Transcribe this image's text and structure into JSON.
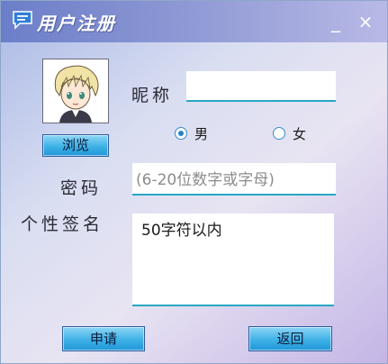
{
  "window": {
    "title": "用户注册",
    "minimize_icon": "minimize-icon",
    "close_icon": "close-icon",
    "app_icon": "chat-bubble-icon",
    "accent": "#27a8c3"
  },
  "avatar": {
    "icon": "anime-avatar-icon"
  },
  "buttons": {
    "browse": "浏览",
    "apply": "申请",
    "back": "返回"
  },
  "form": {
    "nickname_label": "昵称",
    "nickname_value": "",
    "gender": {
      "male_label": "男",
      "female_label": "女",
      "selected": "男"
    },
    "password_label": "密码",
    "password_placeholder": "(6-20位数字或字母)",
    "signature_label": "个性签名",
    "signature_placeholder": "50字符以内"
  },
  "symbols": {
    "minimize": "_",
    "close": "×"
  }
}
